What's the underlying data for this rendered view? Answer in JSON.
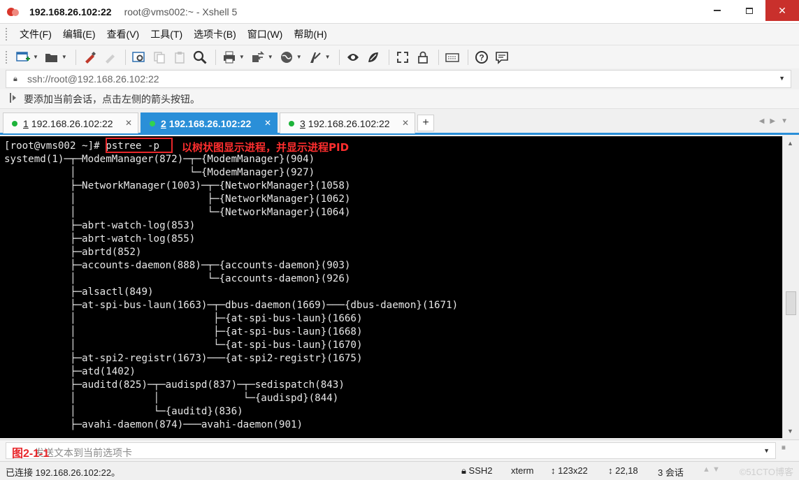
{
  "window": {
    "title_host": "192.168.26.102:22",
    "title_rest": "root@vms002:~ - Xshell 5",
    "minimize_icon": "minimize-icon",
    "maximize_icon": "maximize-icon",
    "close_glyph": "✕"
  },
  "menu": {
    "items": [
      "文件(F)",
      "编辑(E)",
      "查看(V)",
      "工具(T)",
      "选项卡(B)",
      "窗口(W)",
      "帮助(H)"
    ]
  },
  "toolbar": {
    "icons": [
      "new-session-icon",
      "open-folder-icon",
      "reconnect-icon",
      "disconnect-icon",
      "properties-icon",
      "copy-icon",
      "paste-icon",
      "find-icon",
      "print-icon",
      "transfer-icon",
      "globe-icon",
      "font-icon",
      "xftp-icon",
      "xmanager-icon",
      "fullscreen-icon",
      "lock-icon",
      "keyboard-icon",
      "help-icon",
      "chat-icon"
    ]
  },
  "address": {
    "value": "ssh://root@192.168.26.102:22"
  },
  "hint": {
    "text": "要添加当前会话，点击左侧的箭头按钮。"
  },
  "tabs": [
    {
      "num": "1",
      "label": "192.168.26.102:22",
      "active": false
    },
    {
      "num": "2",
      "label": "192.168.26.102:22",
      "active": true
    },
    {
      "num": "3",
      "label": "192.168.26.102:22",
      "active": false
    }
  ],
  "tab_add_label": "+",
  "terminal": {
    "lines": [
      "[root@vms002 ~]# pstree -p",
      "systemd(1)─┬─ModemManager(872)─┬─{ModemManager}(904)",
      "           │                   └─{ModemManager}(927)",
      "           ├─NetworkManager(1003)─┬─{NetworkManager}(1058)",
      "           │                      ├─{NetworkManager}(1062)",
      "           │                      └─{NetworkManager}(1064)",
      "           ├─abrt-watch-log(853)",
      "           ├─abrt-watch-log(855)",
      "           ├─abrtd(852)",
      "           ├─accounts-daemon(888)─┬─{accounts-daemon}(903)",
      "           │                      └─{accounts-daemon}(926)",
      "           ├─alsactl(849)",
      "           ├─at-spi-bus-laun(1663)─┬─dbus-daemon(1669)───{dbus-daemon}(1671)",
      "           │                       ├─{at-spi-bus-laun}(1666)",
      "           │                       ├─{at-spi-bus-laun}(1668)",
      "           │                       └─{at-spi-bus-laun}(1670)",
      "           ├─at-spi2-registr(1673)───{at-spi2-registr}(1675)",
      "           ├─atd(1402)",
      "           ├─auditd(825)─┬─audispd(837)─┬─sedispatch(843)",
      "           │             │              └─{audispd}(844)",
      "           │             └─{auditd}(836)",
      "           ├─avahi-daemon(874)───avahi-daemon(901)"
    ],
    "annotation": "以树状图显示进程，并显示进程PID"
  },
  "compose": {
    "figure_label": "图2-1-1",
    "placeholder": "发送文本到当前选项卡"
  },
  "status": {
    "connection": "已连接 192.168.26.102:22。",
    "protocol": "SSH2",
    "terminal_type": "xterm",
    "size": "123x22",
    "cursor": "22,18",
    "sessions": "3 会话",
    "watermark": "©51CTO博客"
  }
}
